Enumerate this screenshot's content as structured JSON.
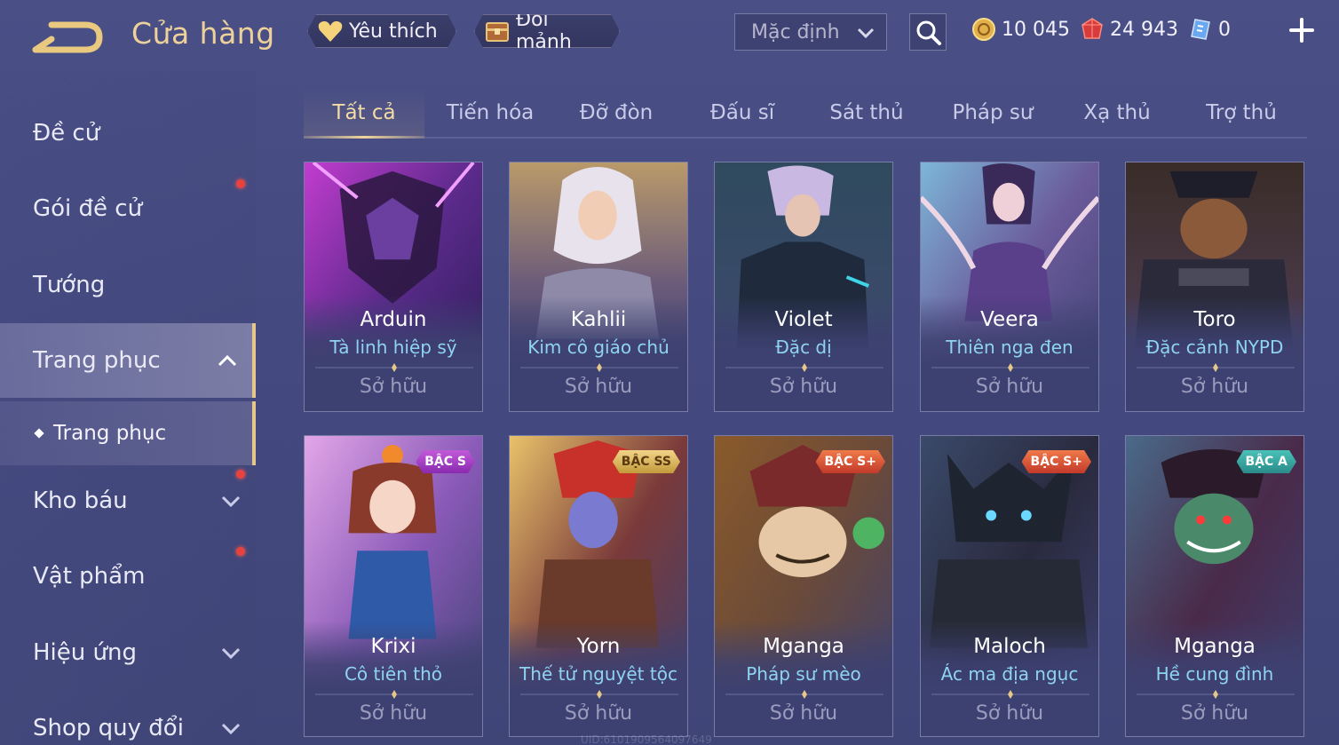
{
  "header": {
    "title": "Cửa hàng",
    "favorites_label": "Yêu thích",
    "trade_label": "Đổi mảnh",
    "sort_value": "Mặc định",
    "currencies": [
      {
        "name": "gold",
        "value": "10 045"
      },
      {
        "name": "voucher",
        "value": "24 943"
      },
      {
        "name": "ticket",
        "value": "0"
      }
    ]
  },
  "sidebar": {
    "items": [
      {
        "label": "Đề cử"
      },
      {
        "label": "Gói đề cử"
      },
      {
        "label": "Tướng"
      },
      {
        "label": "Trang phục"
      },
      {
        "label": "Kho báu"
      },
      {
        "label": "Vật phẩm"
      },
      {
        "label": "Hiệu ứng"
      },
      {
        "label": "Shop quy đổi"
      }
    ],
    "sub_item": "Trang phục"
  },
  "tabs": [
    "Tất cả",
    "Tiến hóa",
    "Đỡ đòn",
    "Đấu sĩ",
    "Sát thủ",
    "Pháp sư",
    "Xạ thủ",
    "Trợ thủ"
  ],
  "cards": [
    {
      "hero": "Arduin",
      "skin": "Tà linh hiệp sỹ",
      "status": "Sở hữu",
      "tier": ""
    },
    {
      "hero": "Kahlii",
      "skin": "Kim cô giáo chủ",
      "status": "Sở hữu",
      "tier": ""
    },
    {
      "hero": "Violet",
      "skin": "Đặc dị",
      "status": "Sở hữu",
      "tier": ""
    },
    {
      "hero": "Veera",
      "skin": "Thiên nga đen",
      "status": "Sở hữu",
      "tier": ""
    },
    {
      "hero": "Toro",
      "skin": "Đặc cảnh NYPD",
      "status": "Sở hữu",
      "tier": ""
    },
    {
      "hero": "Krixi",
      "skin": "Cô tiên thỏ",
      "status": "Sở hữu",
      "tier": "BẬC S"
    },
    {
      "hero": "Yorn",
      "skin": "Thế tử nguyệt tộc",
      "status": "Sở hữu",
      "tier": "BẬC SS"
    },
    {
      "hero": "Mganga",
      "skin": "Pháp sư mèo",
      "status": "Sở hữu",
      "tier": "BẬC S+"
    },
    {
      "hero": "Maloch",
      "skin": "Ác ma địa ngục",
      "status": "Sở hữu",
      "tier": "BẬC S+"
    },
    {
      "hero": "Mganga",
      "skin": "Hề cung đình",
      "status": "Sở hữu",
      "tier": "BẬC A"
    }
  ],
  "uid": "UID:6101909564097649",
  "colors": {
    "accent_gold": "#ecd29a",
    "skin_name": "#8fd3f2",
    "notification": "#e8423e"
  }
}
